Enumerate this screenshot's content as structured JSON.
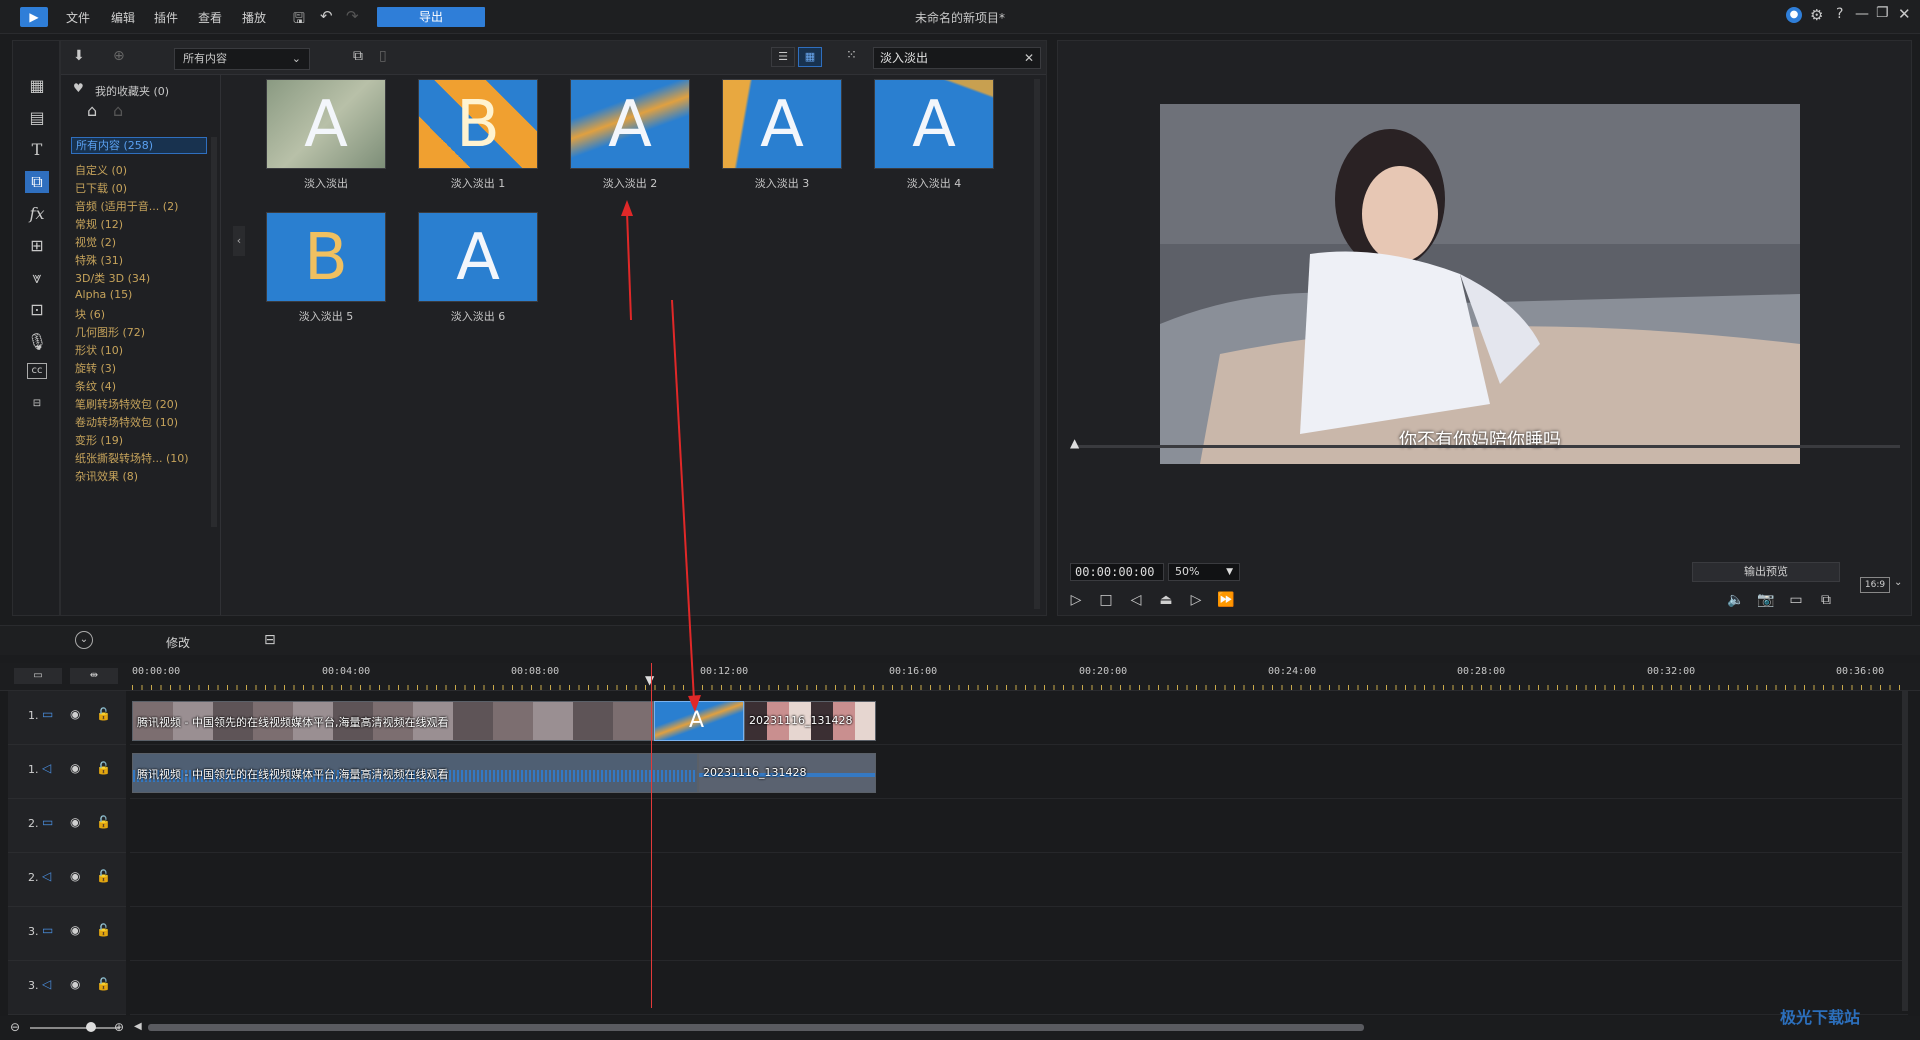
{
  "app": {
    "menu": [
      "文件",
      "编辑",
      "插件",
      "查看",
      "播放"
    ],
    "export_label": "导出",
    "title": "未命名的新项目*",
    "accent": "#2f7ed8"
  },
  "library": {
    "dropdown": "所有内容",
    "search_value": "淡入淡出",
    "favorites": "我的收藏夹 (0)",
    "categories": [
      "所有内容 (258)",
      "自定义  (0)",
      "已下载  (0)",
      "音频 (适用于音...  (2)",
      "常规  (12)",
      "视觉  (2)",
      "特殊  (31)",
      "3D/类 3D  (34)",
      "Alpha  (15)",
      "块  (6)",
      "几何图形  (72)",
      "形状  (10)",
      "旋转  (3)",
      "条纹  (4)",
      "笔刷转场特效包  (20)",
      "卷动转场特效包  (10)",
      "变形  (19)",
      "纸张撕裂转场特...  (10)",
      "杂讯效果  (8)"
    ],
    "items": [
      {
        "label": "淡入淡出",
        "letter": "A"
      },
      {
        "label": "淡入淡出 1",
        "letter": "B"
      },
      {
        "label": "淡入淡出 2",
        "letter": "A"
      },
      {
        "label": "淡入淡出 3",
        "letter": "A"
      },
      {
        "label": "淡入淡出 4",
        "letter": "A"
      },
      {
        "label": "淡入淡出 5",
        "letter": "B"
      },
      {
        "label": "淡入淡出 6",
        "letter": "A"
      }
    ]
  },
  "preview": {
    "subtitle": "你不有你妈陪你睡吗",
    "timecode": "00:00:00:00",
    "zoom": "50%",
    "output_preview": "输出预览",
    "aspect": "16:9"
  },
  "timeline": {
    "modify_label": "修改",
    "ruler": [
      "00:00:00",
      "00:04:00",
      "00:08:00",
      "00:12:00",
      "00:16:00",
      "00:20:00",
      "00:24:00",
      "00:28:00",
      "00:32:00",
      "00:36:00"
    ],
    "tracks": [
      {
        "num": "1.",
        "type": "video"
      },
      {
        "num": "1.",
        "type": "audio"
      },
      {
        "num": "2.",
        "type": "video"
      },
      {
        "num": "2.",
        "type": "audio"
      },
      {
        "num": "3.",
        "type": "video"
      },
      {
        "num": "3.",
        "type": "audio"
      }
    ],
    "clips": {
      "video1_label": "腾讯视频 - 中国领先的在线视频媒体平台,海量高清视频在线观看",
      "video2_label": "20231116_131428",
      "audio1_label": "腾讯视频 - 中国领先的在线视频媒体平台,海量高清视频在线观看",
      "audio2_label": "20231116_131428"
    }
  },
  "watermark": {
    "text": "极光下载站"
  }
}
